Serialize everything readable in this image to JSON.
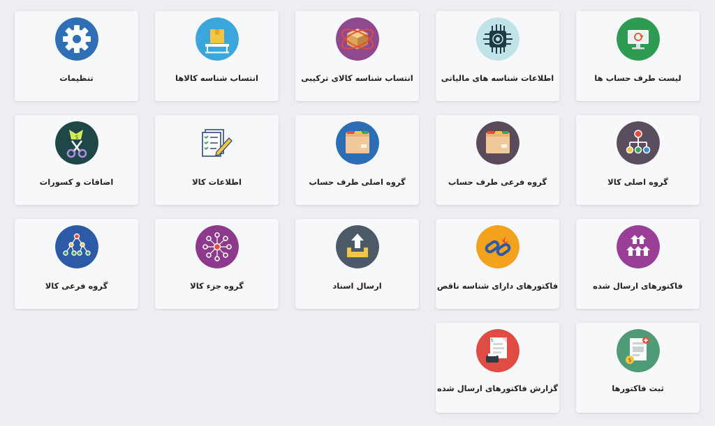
{
  "tiles": [
    {
      "label": "لیست طرف حساب ها",
      "icon": "monitor-refresh-icon",
      "color": "#2e9b52"
    },
    {
      "label": "اطلاعات شناسه های مالیاتی",
      "icon": "circuit-chip-icon",
      "color": "#bfe3e6"
    },
    {
      "label": "انتساب شناسه کالای ترکیبی",
      "icon": "box-orbit-icon",
      "color": "#8e4a8d"
    },
    {
      "label": "انتساب شناسه کالاها",
      "icon": "package-conveyor-icon",
      "color": "#3aa6dc"
    },
    {
      "label": "تنظیمات",
      "icon": "gear-icon",
      "color": "#2f6fb5"
    },
    {
      "label": "گروه اصلی کالا",
      "icon": "hierarchy-icon",
      "color": "#5a4e5e"
    },
    {
      "label": "گروه فرعی طرف حساب",
      "icon": "folder-icon",
      "color": "#5b4a5a"
    },
    {
      "label": "گروه اصلی طرف حساب",
      "icon": "folder-icon",
      "color": "#2d6db5"
    },
    {
      "label": "اطلاعات کالا",
      "icon": "checklist-pencil-icon",
      "color": "#f7f8fa"
    },
    {
      "label": "اضافات و کسورات",
      "icon": "scissors-money-icon",
      "color": "#1f4747"
    },
    {
      "label": "فاکتورهای ارسال شده",
      "icon": "arrows-up-icon",
      "color": "#9b3e97"
    },
    {
      "label": "فاکتورهای دارای شناسه ناقص",
      "icon": "broken-link-icon",
      "color": "#f3a21d"
    },
    {
      "label": "ارسال اسناد",
      "icon": "upload-tray-icon",
      "color": "#4c5a67"
    },
    {
      "label": "گروه جزء کالا",
      "icon": "radial-network-icon",
      "color": "#8d3a8c"
    },
    {
      "label": "گروه فرعی کالا",
      "icon": "tree-network-icon",
      "color": "#2d5aa6"
    },
    {
      "label": "ثبت فاکتورها",
      "icon": "invoice-add-icon",
      "color": "#4f9b77"
    },
    {
      "label": "گزارش فاکتورهای ارسال شده",
      "icon": "invoice-report-icon",
      "color": "#e04b43"
    }
  ]
}
